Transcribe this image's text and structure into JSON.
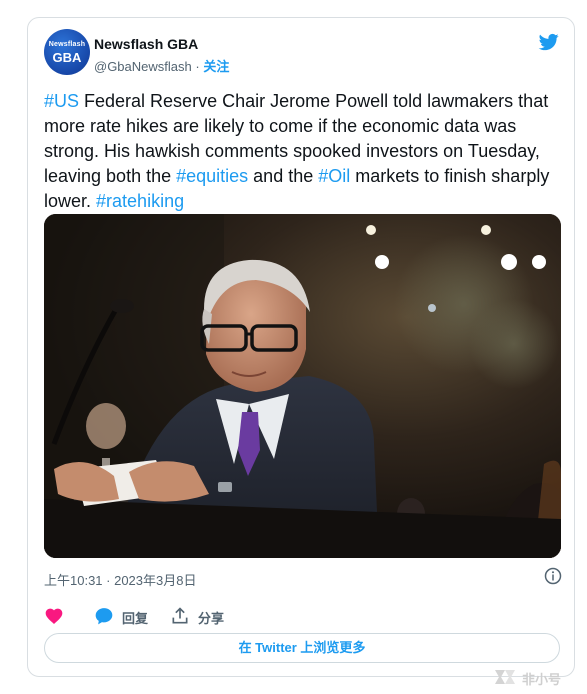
{
  "author": {
    "avatar_top": "Newsflash",
    "avatar_bottom": "GBA",
    "name": "Newsflash GBA",
    "handle": "@GbaNewsflash",
    "separator": " · ",
    "follow_label": "关注"
  },
  "tweet": {
    "segments": [
      {
        "text": "#US",
        "tag": true
      },
      {
        "text": " Federal Reserve Chair Jerome Powell told lawmakers that more rate hikes are likely to come if the economic data was strong. His hawkish comments spooked investors on Tuesday, leaving both the ",
        "tag": false
      },
      {
        "text": "#equities",
        "tag": true
      },
      {
        "text": " and the ",
        "tag": false
      },
      {
        "text": "#Oil",
        "tag": true
      },
      {
        "text": " markets to finish sharply lower. ",
        "tag": false
      },
      {
        "text": "#ratehiking",
        "tag": true
      }
    ]
  },
  "timestamp": "上午10:31 · 2023年3月8日",
  "actions": {
    "reply_label": "回复",
    "share_label": "分享"
  },
  "view_more_label": "在 Twitter 上浏览更多",
  "watermark_text": "非小号",
  "colors": {
    "accent": "#1d9bf0",
    "heart": "#f91880",
    "text": "#0f1419",
    "muted": "#536471"
  },
  "icons": {
    "bird": "twitter-bird-icon",
    "info": "info-icon",
    "like": "heart-icon",
    "reply": "speech-bubble-icon",
    "share": "share-upload-icon"
  }
}
